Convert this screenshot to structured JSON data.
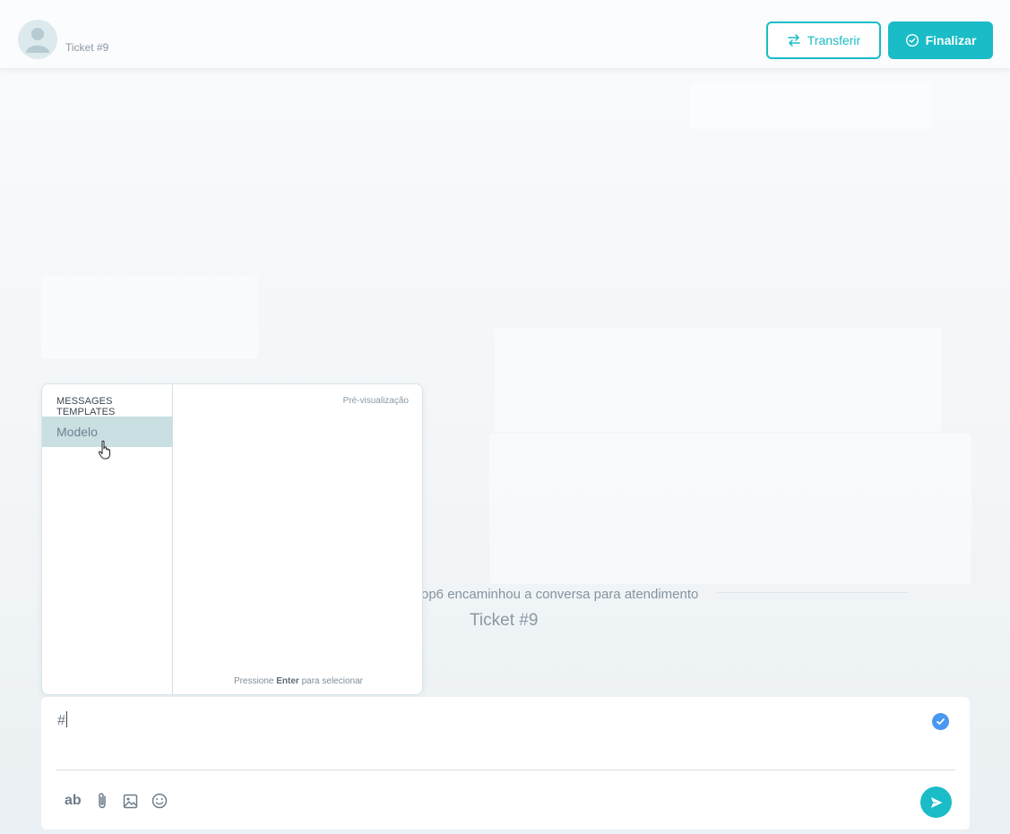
{
  "header": {
    "ticket_label": "Ticket #9",
    "transfer_label": "Transferir",
    "finalize_label": "Finalizar"
  },
  "conversation": {
    "system_message": "op6 encaminhou a conversa para atendimento",
    "ticket_title": "Ticket #9"
  },
  "templates_popup": {
    "title": "MESSAGES TEMPLATES",
    "items": [
      {
        "label": "Modelo",
        "selected": true
      }
    ],
    "preview_label": "Pré-visualização",
    "hint_prefix": "Pressione ",
    "hint_key": "Enter",
    "hint_suffix": " para selecionar"
  },
  "composer": {
    "input_value": "#",
    "tools": {
      "format_label": "ab",
      "attach_icon": "paperclip-icon",
      "image_icon": "image-icon",
      "emoji_icon": "emoji-icon"
    },
    "send_icon": "send-icon",
    "status_icon": "check-circle-icon"
  },
  "colors": {
    "accent": "#19bcc7",
    "selected_item": "#c9dfe2",
    "check_blue": "#4a98f0"
  }
}
